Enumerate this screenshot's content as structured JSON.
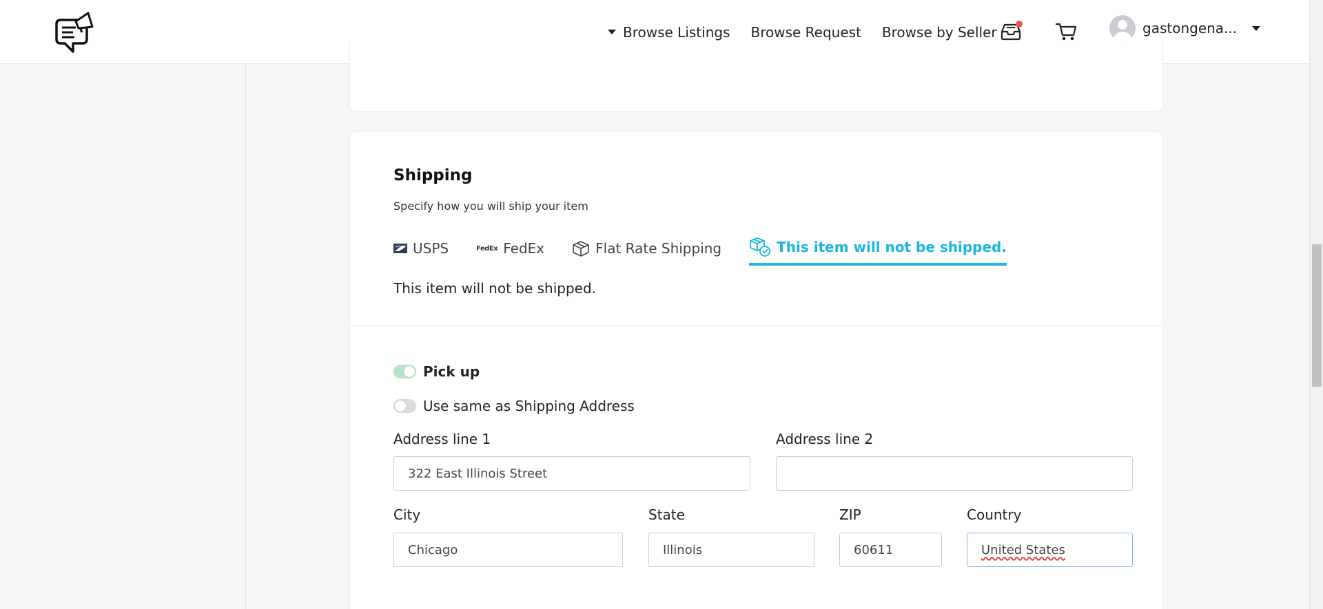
{
  "nav": {
    "browse_listings": "Browse Listings",
    "browse_request": "Browse Request",
    "browse_by_seller": "Browse by Seller",
    "username": "gastongena..."
  },
  "shipping": {
    "title": "Shipping",
    "subtitle": "Specify how you will ship your item",
    "tabs": {
      "usps": "USPS",
      "fedex_logo": "FedEx",
      "fedex": "FedEx",
      "flat_rate": "Flat Rate Shipping",
      "not_shipped": "This item will not be shipped."
    },
    "active_tab": "not_shipped",
    "panel_text": "This item will not be shipped."
  },
  "pickup": {
    "pickup_label": "Pick up",
    "pickup_on": true,
    "same_address_label": "Use same as Shipping Address",
    "same_address_on": false
  },
  "address": {
    "line1_label": "Address line 1",
    "line1_value": "322 East Illinois Street",
    "line2_label": "Address line 2",
    "line2_value": "",
    "city_label": "City",
    "city_value": "Chicago",
    "state_label": "State",
    "state_value": "Illinois",
    "zip_label": "ZIP",
    "zip_value": "60611",
    "country_label": "Country",
    "country_value": "United States"
  },
  "colors": {
    "accent": "#1bb6e0",
    "toggle_on": "#b7e4c9",
    "notification": "#f0554a"
  },
  "icons": [
    "megaphone-chat-logo-icon",
    "inbox-icon",
    "cart-icon",
    "usps-icon",
    "fedex-icon",
    "box-icon",
    "box-check-icon"
  ]
}
